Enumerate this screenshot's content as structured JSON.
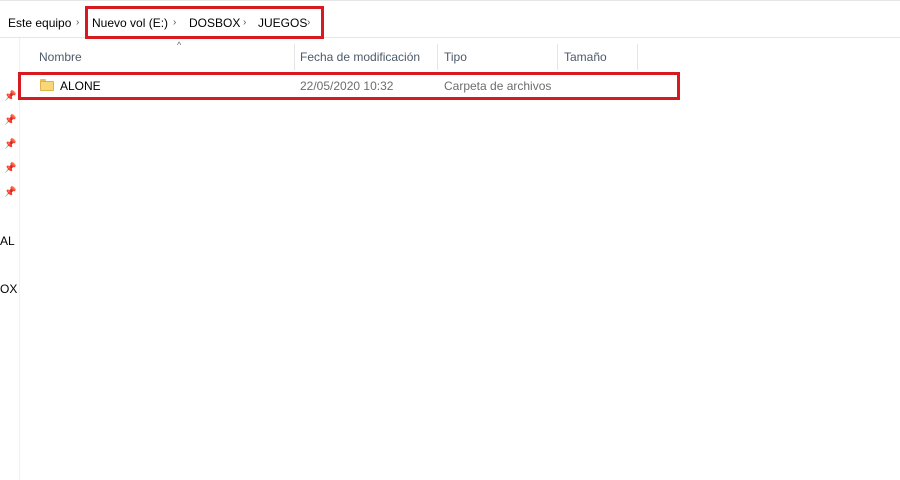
{
  "breadcrumb": {
    "items": [
      "Este equipo",
      "Nuevo vol (E:)",
      "DOSBOX",
      "JUEGOS"
    ],
    "separator": "›"
  },
  "nav_pane": {
    "truncated_items": [
      "AL",
      "OX"
    ],
    "pin_icon": "pin-icon"
  },
  "columns": {
    "name": "Nombre",
    "date": "Fecha de modificación",
    "type": "Tipo",
    "size": "Tamaño",
    "sort_indicator": "^"
  },
  "files": [
    {
      "name": "ALONE",
      "date": "22/05/2020 10:32",
      "type": "Carpeta de archivos",
      "size": "",
      "icon": "folder-icon"
    }
  ],
  "highlight_color": "#d71920"
}
